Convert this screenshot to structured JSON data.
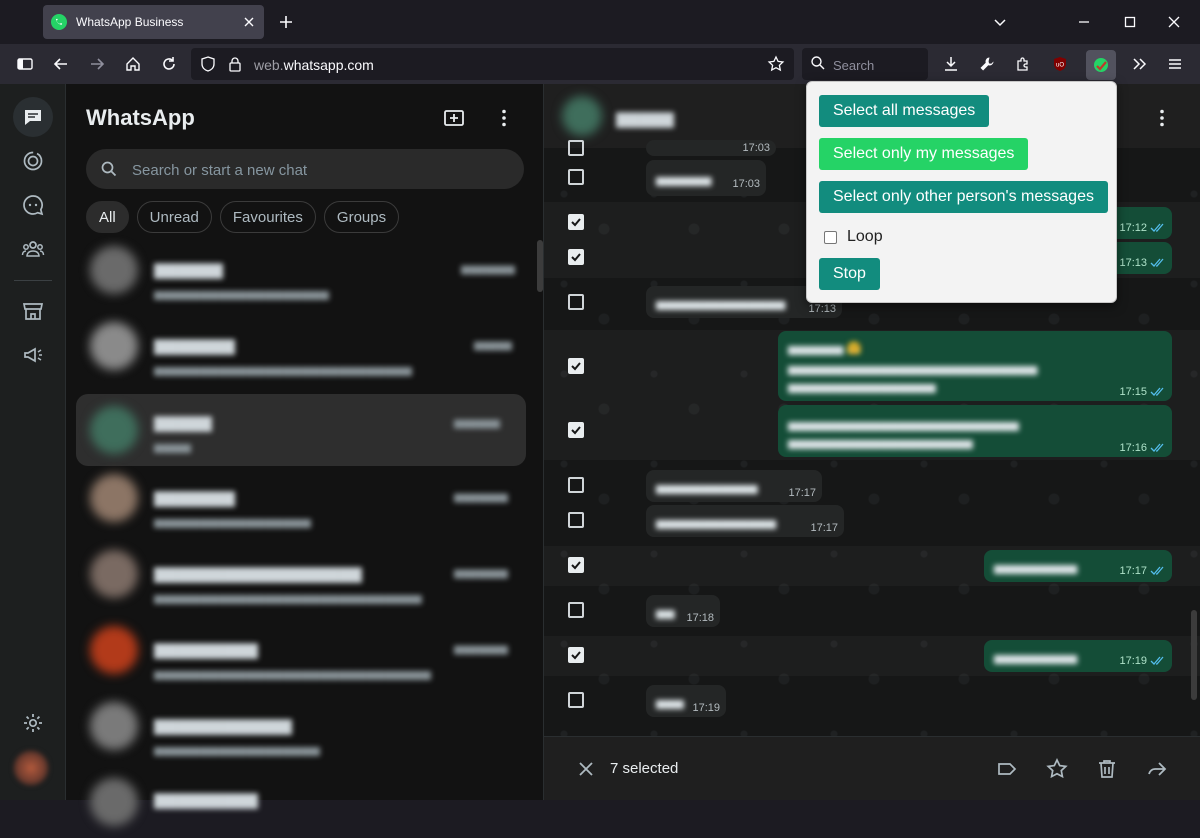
{
  "browser": {
    "tab_title": "WhatsApp Business",
    "url_domain": "whatsapp.com",
    "url_prefix": "web.",
    "search_placeholder": "Search"
  },
  "sidebar": {
    "title": "WhatsApp",
    "search_placeholder": "Search or start a new chat",
    "filters": [
      "All",
      "Unread",
      "Favourites",
      "Groups"
    ],
    "active_filter": "All"
  },
  "conversation": {
    "timestamps": [
      "17:03",
      "17:03",
      "17:12",
      "17:13",
      "17:13",
      "17:15",
      "17:16",
      "17:17",
      "17:17",
      "17:17",
      "17:18",
      "17:19",
      "17:19"
    ]
  },
  "selection_bar": {
    "count_label": "7 selected"
  },
  "popup": {
    "select_all": "Select all messages",
    "select_mine": "Select only my messages",
    "select_other": "Select only other person's messages",
    "loop_label": "Loop",
    "stop": "Stop"
  },
  "colors": {
    "accent_teal": "#128c7e",
    "accent_green": "#25d366",
    "outgoing_bubble": "#144d37"
  }
}
